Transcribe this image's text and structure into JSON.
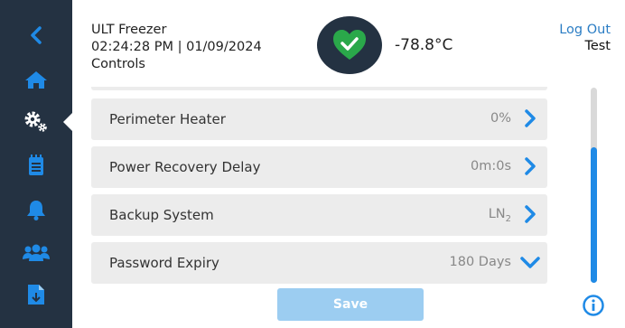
{
  "header": {
    "app_name": "ULT Freezer",
    "datetime": "02:24:28 PM | 01/09/2024",
    "page_name": "Controls",
    "temperature": "-78.8°C",
    "status_icon": "heart-check-icon",
    "logout_label": "Log Out",
    "user": "Test"
  },
  "sidebar": {
    "items": [
      {
        "icon": "back-chevron-icon"
      },
      {
        "icon": "home-icon"
      },
      {
        "icon": "gears-icon",
        "active": true
      },
      {
        "icon": "notepad-icon"
      },
      {
        "icon": "bell-icon"
      },
      {
        "icon": "users-icon"
      },
      {
        "icon": "document-download-icon"
      }
    ]
  },
  "settings": [
    {
      "label": "Perimeter Heater",
      "value": "0%",
      "control": "chevron-right-icon"
    },
    {
      "label": "Power Recovery Delay",
      "value": "0m:0s",
      "control": "chevron-right-icon"
    },
    {
      "label": "Backup System",
      "value": "LN",
      "value_subscript": "2",
      "control": "chevron-right-icon"
    },
    {
      "label": "Password Expiry",
      "value": "180 Days",
      "control": "chevron-down-icon"
    }
  ],
  "save_label": "Save",
  "colors": {
    "sidebar": "#243242",
    "accent": "#1f8ae6",
    "status_ok": "#2aa84a",
    "row_bg": "#ececec",
    "save_disabled": "#9ccdf1"
  }
}
